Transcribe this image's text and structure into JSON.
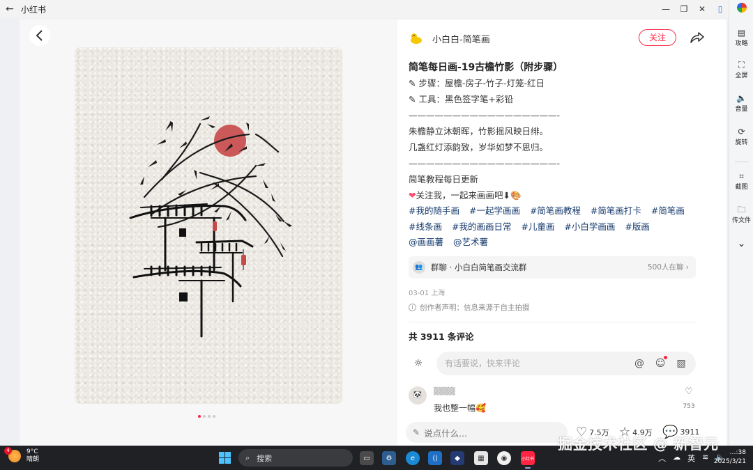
{
  "window": {
    "title": "小红书",
    "back": "←",
    "controls": [
      "—",
      "❐",
      "✕",
      "▯"
    ]
  },
  "sidebar": {
    "items": [
      {
        "label": "攻略",
        "icon": "guide-icon"
      },
      {
        "label": "全屏",
        "icon": "fullscreen-icon"
      },
      {
        "label": "音量",
        "icon": "volume-icon"
      },
      {
        "label": "旋转",
        "icon": "rotate-icon"
      },
      {
        "label": "截图",
        "icon": "crop-icon"
      },
      {
        "label": "传文件",
        "icon": "folder-icon"
      }
    ],
    "more": "⌄"
  },
  "post": {
    "author": "小白白-简笔画",
    "follow": "关注",
    "title": "简笔每日画-19古檐竹影（附步骤）",
    "lines": [
      "✎ 步骤：屋檐-房子-竹子-灯笼-红日",
      "✎ 工具：黑色签字笔+彩铅",
      "—————————————————-",
      "朱檐静立沐朝晖，竹影摇风映日绯。",
      "几盏红灯添韵致，岁华如梦不思归。",
      "—————————————————-",
      "简笔教程每日更新"
    ],
    "follow_line": "关注我，一起来画画吧⬇",
    "tags": [
      "#我的随手画",
      "#一起学画画",
      "#简笔画教程",
      "#简笔画打卡",
      "#简笔画",
      "#线条画",
      "#我的画画日常",
      "#儿童画",
      "#小白学画画",
      "#版画",
      "@画画薯",
      "@艺术薯"
    ],
    "group": {
      "name": "群聊 · 小白白简笔画交流群",
      "count": "500人在聊 ›"
    },
    "meta": "03-01 上海",
    "declaration": "创作者声明：信息来源于自主拍摄",
    "comment_count": "共 3911 条评论",
    "comment_placeholder": "有话要说，快来评论",
    "comments": [
      {
        "name": "▒▒▒▒",
        "text": "我也整一幅🥰",
        "likes": "753"
      }
    ],
    "bottom": {
      "say": "说点什么...",
      "likes": "7.5万",
      "stars": "4.9万",
      "comments": "3911"
    }
  },
  "watermark": "掘金技术社区 @ 新智元",
  "taskbar": {
    "weather_temp": "9°C",
    "weather_desc": "晴朗",
    "weather_badge": "4",
    "search": "搜索",
    "ime": "英",
    "time": "…:38",
    "date": "2025/3/21"
  },
  "colors": {
    "brand": "#ff2442",
    "tag": "#13386c",
    "taskbar": "#202124"
  }
}
